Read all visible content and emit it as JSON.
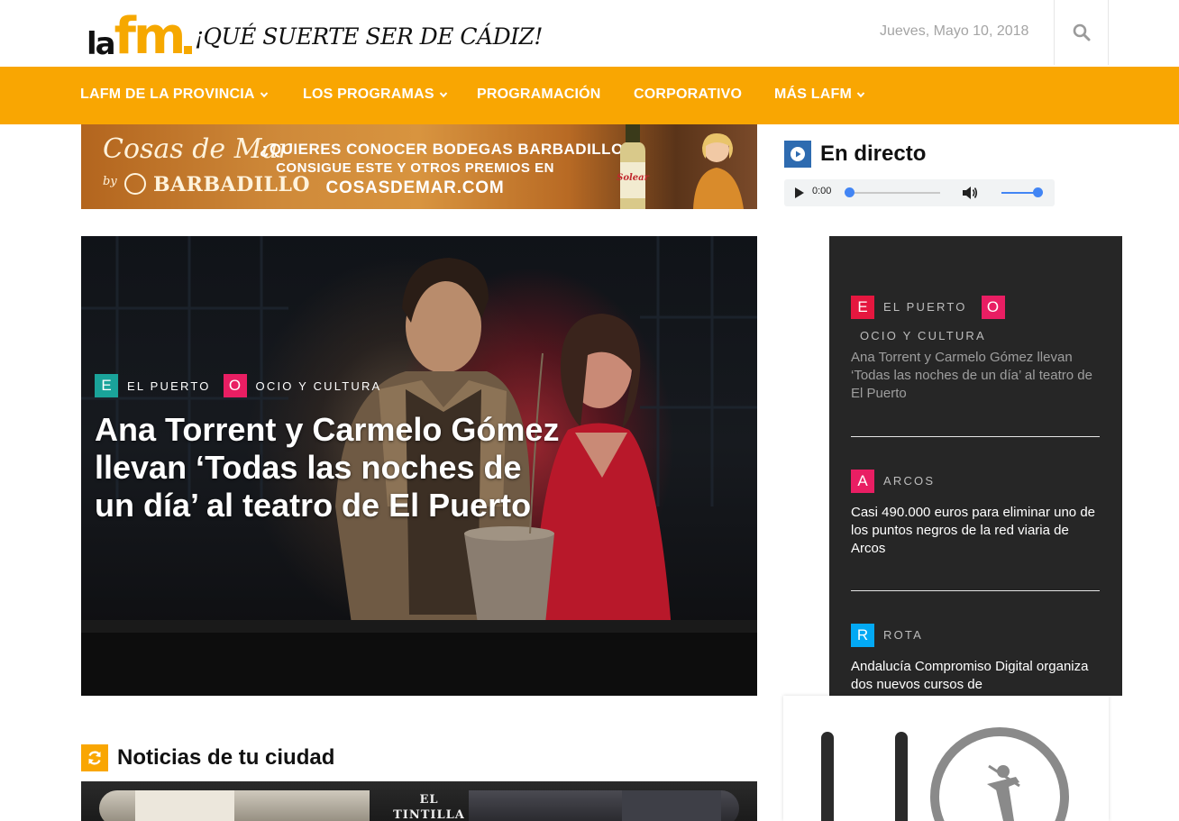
{
  "header": {
    "logo_la": "la",
    "logo_fm": "fm",
    "tagline": "¡QUÉ SUERTE SER DE CÁDIZ!",
    "date": "Jueves, Mayo 10, 2018",
    "search_icon": "search-icon"
  },
  "nav": {
    "items": [
      {
        "label": "LAFM DE LA PROVINCIA",
        "has_dropdown": true
      },
      {
        "label": "LOS PROGRAMAS",
        "has_dropdown": true
      },
      {
        "label": "PROGRAMACIÓN",
        "has_dropdown": false
      },
      {
        "label": "CORPORATIVO",
        "has_dropdown": false
      },
      {
        "label": "MÁS LAFM",
        "has_dropdown": true
      }
    ]
  },
  "banner": {
    "brand_script": "Cosas de Mar",
    "brand_by": "by",
    "brand_name": "BARBADILLO",
    "line1": "¿QUIERES CONOCER BODEGAS BARBADILLO?",
    "line2": "CONSIGUE ESTE Y OTROS PREMIOS EN",
    "line3": "COSASDEMAR.COM",
    "bottle_label": "Solear"
  },
  "hero": {
    "tags": [
      {
        "letter": "E",
        "label": "EL PUERTO",
        "color": "#1aa39a"
      },
      {
        "letter": "O",
        "label": "OCIO Y CULTURA",
        "color": "#e91e63"
      }
    ],
    "title": "Ana Torrent y Carmelo Gómez llevan ‘Todas las noches de un día’ al teatro de El Puerto"
  },
  "live": {
    "title": "En directo",
    "time": "0:00",
    "colors": {
      "icon_bg": "#2e6bb0",
      "accent": "#4285f4"
    }
  },
  "side_list": {
    "items": [
      {
        "tags": [
          {
            "letter": "E",
            "label": "EL PUERTO",
            "color": "#e5173f"
          },
          {
            "letter": "O",
            "label": "OCIO Y CULTURA",
            "color": "#e91e63"
          }
        ],
        "text": "Ana Torrent y Carmelo Gómez llevan ‘Todas las noches de un día’ al teatro de El Puerto",
        "text_color": "#9e9e9e"
      },
      {
        "tags": [
          {
            "letter": "A",
            "label": "ARCOS",
            "color": "#e91e63"
          }
        ],
        "text": "Casi 490.000 euros para eliminar uno de los puntos negros de la red viaria de Arcos",
        "text_color": "#ffffff"
      },
      {
        "tags": [
          {
            "letter": "R",
            "label": "ROTA",
            "color": "#03a9f4"
          }
        ],
        "text": "Andalucía Compromiso Digital organiza dos nuevos cursos de",
        "text_color": "#ffffff"
      }
    ]
  },
  "news": {
    "title": "Noticias de tu ciudad",
    "image_text": "EL TINTILLA DE ROTA"
  },
  "colors": {
    "brand_orange": "#f9a602",
    "dark_panel": "#262626"
  }
}
